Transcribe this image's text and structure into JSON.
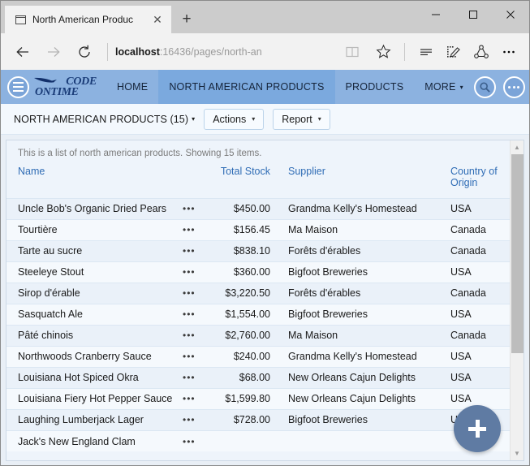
{
  "browser": {
    "tab": {
      "title": "North American Produc",
      "favicon": "page-icon",
      "close": "✕"
    },
    "newtab_label": "+",
    "window_controls": {
      "minimize": "minimize-icon",
      "maximize": "maximize-icon",
      "close": "close-icon"
    },
    "address": {
      "host": "localhost",
      "path": ":16436/pages/north-an"
    },
    "icons": {
      "back": "back-arrow-icon",
      "forward": "forward-arrow-icon",
      "refresh": "refresh-icon",
      "reading_view": "book-icon",
      "favorite": "star-icon",
      "hub": "hub-lines-icon",
      "notes": "web-note-icon",
      "share": "share-icon",
      "settings": "ellipsis-icon"
    }
  },
  "appnav": {
    "menu_icon": "hamburger-icon",
    "logo": {
      "top": "CODE",
      "bottom": "ONTIME",
      "wing": "wing-icon"
    },
    "items": [
      {
        "label": "HOME",
        "active": false,
        "caret": false
      },
      {
        "label": "NORTH AMERICAN PRODUCTS",
        "active": true,
        "caret": false
      },
      {
        "label": "PRODUCTS",
        "active": false,
        "caret": false
      },
      {
        "label": "MORE",
        "active": false,
        "caret": true
      }
    ],
    "search_icon": "search-icon",
    "more_icon": "ellipsis-icon",
    "caret": "▾",
    "background": "#8cb2e0",
    "active_background": "#7ba9de"
  },
  "actionbar": {
    "view_selector": "NORTH AMERICAN PRODUCTS (15)",
    "caret": "▾",
    "buttons": [
      {
        "label": "Actions"
      },
      {
        "label": "Report"
      }
    ]
  },
  "content": {
    "note": "This is a list of north american products. Showing 15 items.",
    "columns": [
      {
        "key": "name",
        "label": "Name",
        "align": "left"
      },
      {
        "key": "menu",
        "label": "",
        "align": "left"
      },
      {
        "key": "total_stock",
        "label": "Total Stock",
        "align": "right"
      },
      {
        "key": "supplier",
        "label": "Supplier",
        "align": "left"
      },
      {
        "key": "country",
        "label": "Country of Origin",
        "align": "left"
      }
    ],
    "row_menu_glyph": "•••",
    "rows": [
      {
        "name": "Uncle Bob's Organic Dried Pears",
        "total_stock": "$450.00",
        "supplier": "Grandma Kelly's Homestead",
        "country": "USA"
      },
      {
        "name": "Tourtière",
        "total_stock": "$156.45",
        "supplier": "Ma Maison",
        "country": "Canada"
      },
      {
        "name": "Tarte au sucre",
        "total_stock": "$838.10",
        "supplier": "Forêts d'érables",
        "country": "Canada"
      },
      {
        "name": "Steeleye Stout",
        "total_stock": "$360.00",
        "supplier": "Bigfoot Breweries",
        "country": "USA"
      },
      {
        "name": "Sirop d'érable",
        "total_stock": "$3,220.50",
        "supplier": "Forêts d'érables",
        "country": "Canada"
      },
      {
        "name": "Sasquatch Ale",
        "total_stock": "$1,554.00",
        "supplier": "Bigfoot Breweries",
        "country": "USA"
      },
      {
        "name": "Pâté chinois",
        "total_stock": "$2,760.00",
        "supplier": "Ma Maison",
        "country": "Canada"
      },
      {
        "name": "Northwoods Cranberry Sauce",
        "total_stock": "$240.00",
        "supplier": "Grandma Kelly's Homestead",
        "country": "USA"
      },
      {
        "name": "Louisiana Hot Spiced Okra",
        "total_stock": "$68.00",
        "supplier": "New Orleans Cajun Delights",
        "country": "USA"
      },
      {
        "name": "Louisiana Fiery Hot Pepper Sauce",
        "total_stock": "$1,599.80",
        "supplier": "New Orleans Cajun Delights",
        "country": "USA"
      },
      {
        "name": "Laughing Lumberjack Lager",
        "total_stock": "$728.00",
        "supplier": "Bigfoot Breweries",
        "country": "USA"
      },
      {
        "name": "Jack's New England Clam",
        "total_stock": "",
        "supplier": "",
        "country": ""
      }
    ],
    "scrollbar": {
      "up": "▲",
      "down": "▼",
      "thumb_position_percent": 0
    },
    "fab": {
      "icon": "plus-icon",
      "color": "#5f7ba3"
    }
  }
}
